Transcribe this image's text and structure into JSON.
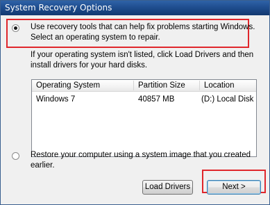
{
  "window": {
    "title": "System Recovery Options"
  },
  "option1": {
    "selected": true,
    "line1": "Use recovery tools that can help fix problems starting Windows.",
    "line2": "Select an operating system to repair."
  },
  "info": {
    "line1": "If your operating system isn't listed, click Load Drivers and then",
    "line2": "install drivers for your hard disks."
  },
  "os_list": {
    "columns": [
      "Operating System",
      "Partition Size",
      "Location"
    ],
    "rows": [
      [
        "Windows 7",
        "40857 MB",
        "(D:) Local Disk"
      ]
    ]
  },
  "option2": {
    "selected": false,
    "line1": "Restore your computer using a system image that you created",
    "line2": "earlier."
  },
  "buttons": {
    "load_drivers": "Load Drivers",
    "next": "Next >"
  },
  "colors": {
    "highlight": "#e0262b",
    "titlebar": "#1c4a8a"
  }
}
